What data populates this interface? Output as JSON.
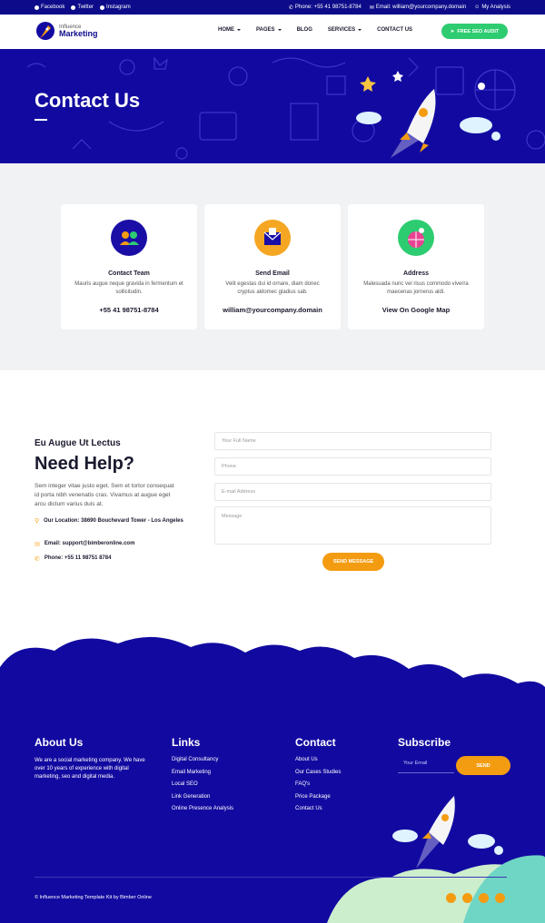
{
  "topbar": {
    "social": [
      {
        "label": "Facebook",
        "icon": "facebook-icon"
      },
      {
        "label": "Twitter",
        "icon": "twitter-icon"
      },
      {
        "label": "Instagram",
        "icon": "instagram-icon"
      }
    ],
    "phone": "Phone: +55 41 98751-8784",
    "email": "Email: william@yourcompany.domain",
    "account": "My Analysis"
  },
  "nav": {
    "logo_top": "Influence",
    "logo_bottom": "Marketing",
    "items": [
      {
        "label": "HOME",
        "dropdown": true
      },
      {
        "label": "PAGES",
        "dropdown": true
      },
      {
        "label": "BLOG",
        "dropdown": false
      },
      {
        "label": "SERVICES",
        "dropdown": true
      },
      {
        "label": "CONTACT US",
        "dropdown": false
      }
    ],
    "cta": "FREE SEO AUDIT"
  },
  "hero": {
    "title": "Contact Us"
  },
  "cards": [
    {
      "title": "Contact Team",
      "desc": "Mauris augue neque gravida in fermentum et sollicitudin.",
      "value": "+55 41 98751-8784",
      "color": "#1a0ea6"
    },
    {
      "title": "Send Email",
      "desc": "Velit egestas dui id ornare, diam donec cryptus aldomec gladius sab.",
      "value": "william@yourcompany.domain",
      "color": "#f5a623"
    },
    {
      "title": "Address",
      "desc": "Malesuada nunc vel risus commodo viverra maecenas jornerus aldi.",
      "value": "View On Google Map",
      "color": "#2ecc71"
    }
  ],
  "help": {
    "eyebrow": "Eu Augue Ut Lectus",
    "title": "Need Help?",
    "intro": "Sem integer vitae justo eget. Sem et tortor consequat id porta nibh venenatis cras. Vivamus at augue eget arcu dictum varius duis at.",
    "location": "Our Location: 38690 Bouchevard Tower - Los Angeles",
    "email": "Email: support@bimberonline.com",
    "phone": "Phone: +55 11 98751 8784",
    "form": {
      "name_placeholder": "Your Full Name",
      "phone_placeholder": "Phone",
      "email_placeholder": "E-mail Address",
      "message_placeholder": "Message",
      "submit": "SEND MESSAGE"
    }
  },
  "footer": {
    "about_title": "About Us",
    "about_text": "We are a social marketing company. We have over 10 years of experience with digital marketing, seo and digital media.",
    "links_title": "Links",
    "links": [
      "Digital Consultancy",
      "Email Marketing",
      "Local SEO",
      "Link Generation",
      "Online Presence Analysis"
    ],
    "contact_title": "Contact",
    "contact_links": [
      "About Us",
      "Our Cases Studies",
      "FAQ's",
      "Price Package",
      "Contact Us"
    ],
    "subscribe_title": "Subscribe",
    "subscribe_placeholder": "Your Email",
    "subscribe_button": "SEND",
    "copyright": "© Influence Marketing Template Kit by Bimber Online",
    "social_icons": [
      "facebook-icon",
      "twitter-icon",
      "instagram-icon",
      "youtube-icon"
    ]
  },
  "colors": {
    "brand": "#120aa0",
    "accent": "#f39c12",
    "green": "#2ecc71"
  }
}
